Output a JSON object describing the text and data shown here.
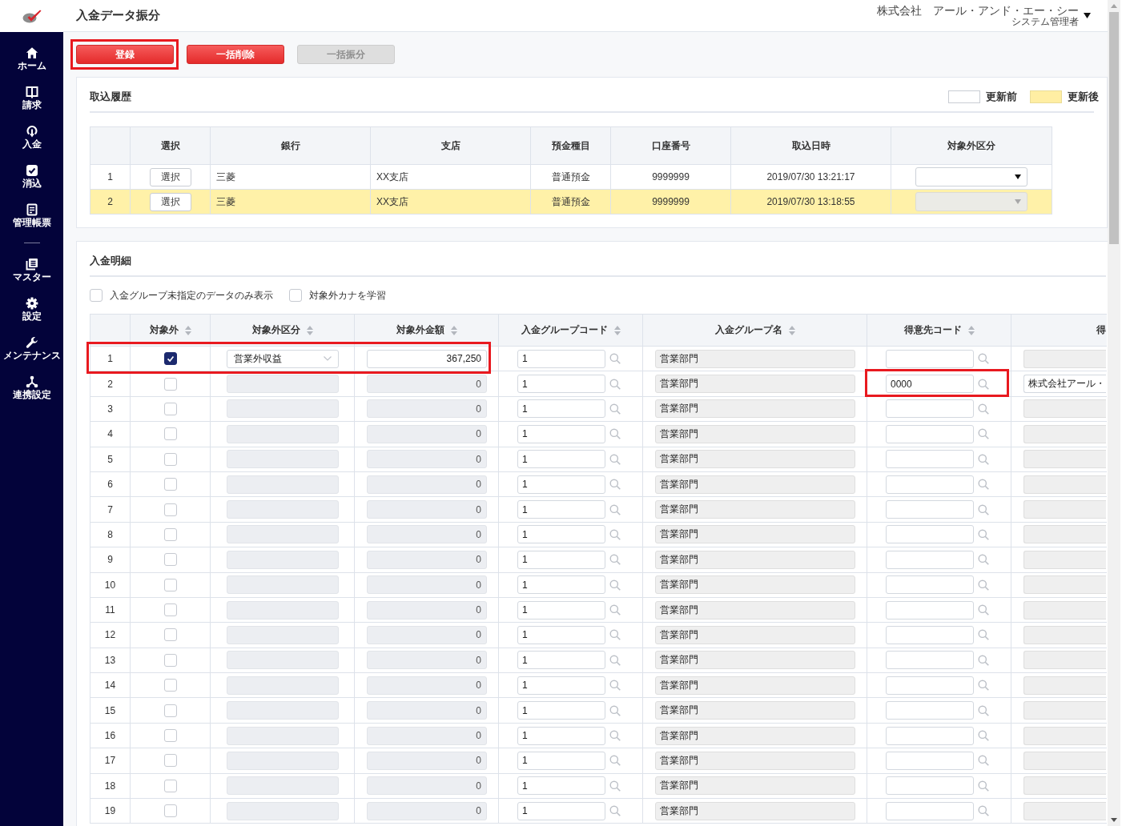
{
  "sidebar": {
    "sections": [
      {
        "items": [
          {
            "label": "ホーム"
          },
          {
            "label": "請求"
          },
          {
            "label": "入金"
          },
          {
            "label": "消込"
          },
          {
            "label": "管理帳票"
          }
        ]
      },
      {
        "items": [
          {
            "label": "マスター"
          },
          {
            "label": "設定"
          },
          {
            "label": "メンテナンス"
          },
          {
            "label": "連携設定"
          }
        ]
      }
    ]
  },
  "header": {
    "title": "入金データ振分",
    "company": "株式会社　アール・アンド・エー・シー",
    "user_role": "システム管理者"
  },
  "toolbar": {
    "buttons": [
      {
        "label": "登録",
        "disabled": false,
        "highlighted": true
      },
      {
        "label": "一括削除",
        "disabled": false,
        "highlighted": false
      },
      {
        "label": "一括振分",
        "disabled": true,
        "highlighted": false
      }
    ]
  },
  "import_history": {
    "title": "取込履歴",
    "legend": [
      {
        "label": "更新前",
        "updated": false
      },
      {
        "label": "更新後",
        "updated": true
      }
    ],
    "table": {
      "columns": [
        "選択",
        "銀行",
        "支店",
        "預金種目",
        "口座番号",
        "取込日時",
        "対象外区分"
      ],
      "rows": [
        {
          "no": "1",
          "select_button": "選択",
          "bank": "三菱",
          "branch": "XX支店",
          "deposit_type": "普通預金",
          "account_number": "9999999",
          "imported_at": "2019/07/30 13:21:17",
          "exclusion_disabled": false,
          "updated": false
        },
        {
          "no": "2",
          "select_button": "選択",
          "bank": "三菱",
          "branch": "XX支店",
          "deposit_type": "普通預金",
          "account_number": "9999999",
          "imported_at": "2019/07/30 13:18:55",
          "exclusion_disabled": true,
          "updated": true
        }
      ]
    }
  },
  "payment_details": {
    "title": "入金明細",
    "filters": [
      {
        "label": "入金グループ未指定のデータのみ表示",
        "checked": false
      },
      {
        "label": "対象外カナを学習",
        "checked": false
      }
    ],
    "table": {
      "columns": [
        {
          "label": "対象外",
          "sortable": true
        },
        {
          "label": "対象外区分",
          "sortable": true
        },
        {
          "label": "対象外金額",
          "sortable": true
        },
        {
          "label": "入金グループコード",
          "sortable": true
        },
        {
          "label": "入金グループ名",
          "sortable": true
        },
        {
          "label": "得意先コード",
          "sortable": true
        },
        {
          "label": "得",
          "sortable": false
        }
      ],
      "rows": [
        {
          "no": "1",
          "excluded": true,
          "exclusion_type": "営業外収益",
          "amount": "367,250",
          "group_code": "1",
          "group_name": "営業部門",
          "highlighted": true,
          "customer_code_highlighted": false
        },
        {
          "no": "2",
          "excluded": false,
          "amount": "0",
          "group_code": "1",
          "group_name": "営業部門",
          "customer_code": "0000",
          "customer_name": "株式会社アール・",
          "highlighted": false,
          "customer_code_highlighted": true
        },
        {
          "no": "3",
          "excluded": false,
          "amount": "0",
          "group_code": "1",
          "group_name": "営業部門",
          "highlighted": false,
          "customer_code_highlighted": false
        },
        {
          "no": "4",
          "excluded": false,
          "amount": "0",
          "group_code": "1",
          "group_name": "営業部門",
          "highlighted": false,
          "customer_code_highlighted": false
        },
        {
          "no": "5",
          "excluded": false,
          "amount": "0",
          "group_code": "1",
          "group_name": "営業部門",
          "highlighted": false,
          "customer_code_highlighted": false
        },
        {
          "no": "6",
          "excluded": false,
          "amount": "0",
          "group_code": "1",
          "group_name": "営業部門",
          "highlighted": false,
          "customer_code_highlighted": false
        },
        {
          "no": "7",
          "excluded": false,
          "amount": "0",
          "group_code": "1",
          "group_name": "営業部門",
          "highlighted": false,
          "customer_code_highlighted": false
        },
        {
          "no": "8",
          "excluded": false,
          "amount": "0",
          "group_code": "1",
          "group_name": "営業部門",
          "highlighted": false,
          "customer_code_highlighted": false
        },
        {
          "no": "9",
          "excluded": false,
          "amount": "0",
          "group_code": "1",
          "group_name": "営業部門",
          "highlighted": false,
          "customer_code_highlighted": false
        },
        {
          "no": "10",
          "excluded": false,
          "amount": "0",
          "group_code": "1",
          "group_name": "営業部門",
          "highlighted": false,
          "customer_code_highlighted": false
        },
        {
          "no": "11",
          "excluded": false,
          "amount": "0",
          "group_code": "1",
          "group_name": "営業部門",
          "highlighted": false,
          "customer_code_highlighted": false
        },
        {
          "no": "12",
          "excluded": false,
          "amount": "0",
          "group_code": "1",
          "group_name": "営業部門",
          "highlighted": false,
          "customer_code_highlighted": false
        },
        {
          "no": "13",
          "excluded": false,
          "amount": "0",
          "group_code": "1",
          "group_name": "営業部門",
          "highlighted": false,
          "customer_code_highlighted": false
        },
        {
          "no": "14",
          "excluded": false,
          "amount": "0",
          "group_code": "1",
          "group_name": "営業部門",
          "highlighted": false,
          "customer_code_highlighted": false
        },
        {
          "no": "15",
          "excluded": false,
          "amount": "0",
          "group_code": "1",
          "group_name": "営業部門",
          "highlighted": false,
          "customer_code_highlighted": false
        },
        {
          "no": "16",
          "excluded": false,
          "amount": "0",
          "group_code": "1",
          "group_name": "営業部門",
          "highlighted": false,
          "customer_code_highlighted": false
        },
        {
          "no": "17",
          "excluded": false,
          "amount": "0",
          "group_code": "1",
          "group_name": "営業部門",
          "highlighted": false,
          "customer_code_highlighted": false
        },
        {
          "no": "18",
          "excluded": false,
          "amount": "0",
          "group_code": "1",
          "group_name": "営業部門",
          "highlighted": false,
          "customer_code_highlighted": false
        },
        {
          "no": "19",
          "excluded": false,
          "amount": "0",
          "group_code": "1",
          "group_name": "営業部門",
          "highlighted": false,
          "customer_code_highlighted": false
        }
      ]
    }
  }
}
